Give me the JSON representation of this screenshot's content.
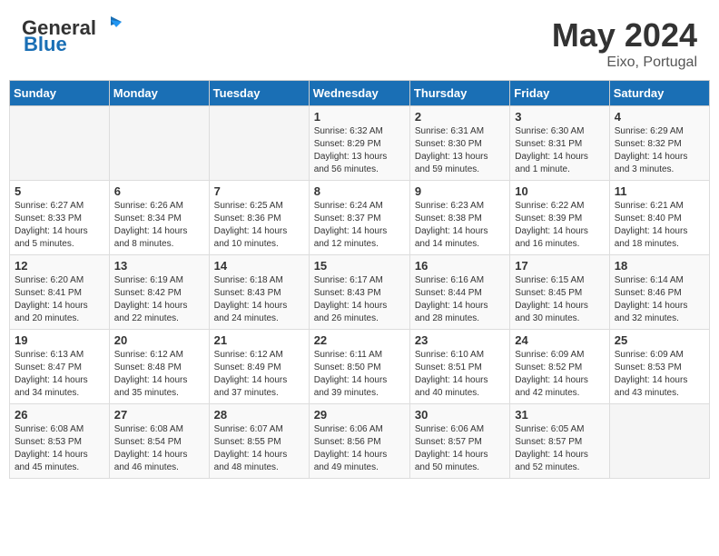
{
  "header": {
    "logo_general": "General",
    "logo_blue": "Blue",
    "month_year": "May 2024",
    "location": "Eixo, Portugal"
  },
  "calendar": {
    "days_of_week": [
      "Sunday",
      "Monday",
      "Tuesday",
      "Wednesday",
      "Thursday",
      "Friday",
      "Saturday"
    ],
    "weeks": [
      [
        {
          "day": "",
          "info": ""
        },
        {
          "day": "",
          "info": ""
        },
        {
          "day": "",
          "info": ""
        },
        {
          "day": "1",
          "info": "Sunrise: 6:32 AM\nSunset: 8:29 PM\nDaylight: 13 hours\nand 56 minutes."
        },
        {
          "day": "2",
          "info": "Sunrise: 6:31 AM\nSunset: 8:30 PM\nDaylight: 13 hours\nand 59 minutes."
        },
        {
          "day": "3",
          "info": "Sunrise: 6:30 AM\nSunset: 8:31 PM\nDaylight: 14 hours\nand 1 minute."
        },
        {
          "day": "4",
          "info": "Sunrise: 6:29 AM\nSunset: 8:32 PM\nDaylight: 14 hours\nand 3 minutes."
        }
      ],
      [
        {
          "day": "5",
          "info": "Sunrise: 6:27 AM\nSunset: 8:33 PM\nDaylight: 14 hours\nand 5 minutes."
        },
        {
          "day": "6",
          "info": "Sunrise: 6:26 AM\nSunset: 8:34 PM\nDaylight: 14 hours\nand 8 minutes."
        },
        {
          "day": "7",
          "info": "Sunrise: 6:25 AM\nSunset: 8:36 PM\nDaylight: 14 hours\nand 10 minutes."
        },
        {
          "day": "8",
          "info": "Sunrise: 6:24 AM\nSunset: 8:37 PM\nDaylight: 14 hours\nand 12 minutes."
        },
        {
          "day": "9",
          "info": "Sunrise: 6:23 AM\nSunset: 8:38 PM\nDaylight: 14 hours\nand 14 minutes."
        },
        {
          "day": "10",
          "info": "Sunrise: 6:22 AM\nSunset: 8:39 PM\nDaylight: 14 hours\nand 16 minutes."
        },
        {
          "day": "11",
          "info": "Sunrise: 6:21 AM\nSunset: 8:40 PM\nDaylight: 14 hours\nand 18 minutes."
        }
      ],
      [
        {
          "day": "12",
          "info": "Sunrise: 6:20 AM\nSunset: 8:41 PM\nDaylight: 14 hours\nand 20 minutes."
        },
        {
          "day": "13",
          "info": "Sunrise: 6:19 AM\nSunset: 8:42 PM\nDaylight: 14 hours\nand 22 minutes."
        },
        {
          "day": "14",
          "info": "Sunrise: 6:18 AM\nSunset: 8:43 PM\nDaylight: 14 hours\nand 24 minutes."
        },
        {
          "day": "15",
          "info": "Sunrise: 6:17 AM\nSunset: 8:43 PM\nDaylight: 14 hours\nand 26 minutes."
        },
        {
          "day": "16",
          "info": "Sunrise: 6:16 AM\nSunset: 8:44 PM\nDaylight: 14 hours\nand 28 minutes."
        },
        {
          "day": "17",
          "info": "Sunrise: 6:15 AM\nSunset: 8:45 PM\nDaylight: 14 hours\nand 30 minutes."
        },
        {
          "day": "18",
          "info": "Sunrise: 6:14 AM\nSunset: 8:46 PM\nDaylight: 14 hours\nand 32 minutes."
        }
      ],
      [
        {
          "day": "19",
          "info": "Sunrise: 6:13 AM\nSunset: 8:47 PM\nDaylight: 14 hours\nand 34 minutes."
        },
        {
          "day": "20",
          "info": "Sunrise: 6:12 AM\nSunset: 8:48 PM\nDaylight: 14 hours\nand 35 minutes."
        },
        {
          "day": "21",
          "info": "Sunrise: 6:12 AM\nSunset: 8:49 PM\nDaylight: 14 hours\nand 37 minutes."
        },
        {
          "day": "22",
          "info": "Sunrise: 6:11 AM\nSunset: 8:50 PM\nDaylight: 14 hours\nand 39 minutes."
        },
        {
          "day": "23",
          "info": "Sunrise: 6:10 AM\nSunset: 8:51 PM\nDaylight: 14 hours\nand 40 minutes."
        },
        {
          "day": "24",
          "info": "Sunrise: 6:09 AM\nSunset: 8:52 PM\nDaylight: 14 hours\nand 42 minutes."
        },
        {
          "day": "25",
          "info": "Sunrise: 6:09 AM\nSunset: 8:53 PM\nDaylight: 14 hours\nand 43 minutes."
        }
      ],
      [
        {
          "day": "26",
          "info": "Sunrise: 6:08 AM\nSunset: 8:53 PM\nDaylight: 14 hours\nand 45 minutes."
        },
        {
          "day": "27",
          "info": "Sunrise: 6:08 AM\nSunset: 8:54 PM\nDaylight: 14 hours\nand 46 minutes."
        },
        {
          "day": "28",
          "info": "Sunrise: 6:07 AM\nSunset: 8:55 PM\nDaylight: 14 hours\nand 48 minutes."
        },
        {
          "day": "29",
          "info": "Sunrise: 6:06 AM\nSunset: 8:56 PM\nDaylight: 14 hours\nand 49 minutes."
        },
        {
          "day": "30",
          "info": "Sunrise: 6:06 AM\nSunset: 8:57 PM\nDaylight: 14 hours\nand 50 minutes."
        },
        {
          "day": "31",
          "info": "Sunrise: 6:05 AM\nSunset: 8:57 PM\nDaylight: 14 hours\nand 52 minutes."
        },
        {
          "day": "",
          "info": ""
        }
      ]
    ]
  }
}
